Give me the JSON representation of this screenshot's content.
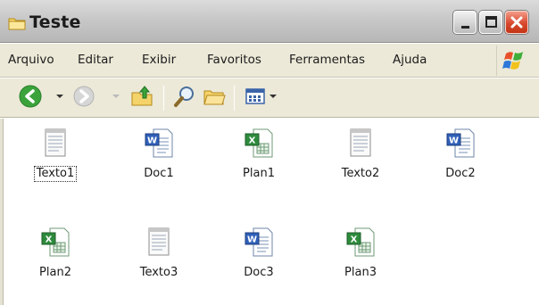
{
  "window": {
    "title": "Teste"
  },
  "menu": {
    "items": [
      {
        "label": "Arquivo"
      },
      {
        "label": "Editar"
      },
      {
        "label": "Exibir"
      },
      {
        "label": "Favoritos"
      },
      {
        "label": "Ferramentas"
      },
      {
        "label": "Ajuda"
      }
    ]
  },
  "toolbar": {
    "icons": [
      "back-icon",
      "forward-icon",
      "up-folder-icon",
      "search-icon",
      "folders-icon",
      "views-icon"
    ]
  },
  "files": [
    {
      "name": "Texto1",
      "type": "text",
      "selected": true
    },
    {
      "name": "Doc1",
      "type": "word"
    },
    {
      "name": "Plan1",
      "type": "excel"
    },
    {
      "name": "Texto2",
      "type": "text"
    },
    {
      "name": "Doc2",
      "type": "word"
    },
    {
      "name": "Plan2",
      "type": "excel"
    },
    {
      "name": "Texto3",
      "type": "text"
    },
    {
      "name": "Doc3",
      "type": "word"
    },
    {
      "name": "Plan3",
      "type": "excel"
    }
  ],
  "colors": {
    "title_bar": "#c8c8c8",
    "close_button": "#d8492e",
    "menu_bar": "#ece9d8",
    "word_blue": "#2f5fb8",
    "excel_green": "#2e8b3d"
  }
}
